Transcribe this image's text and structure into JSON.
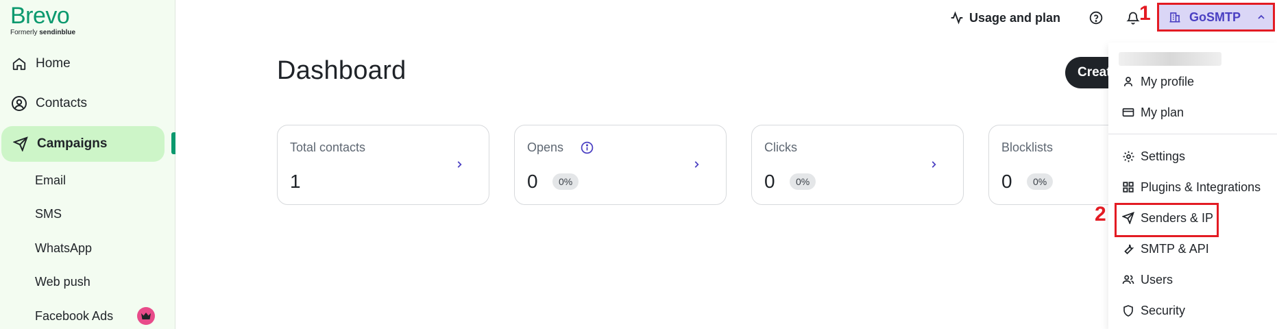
{
  "brand": {
    "name": "Brevo",
    "formerly_prefix": "Formerly",
    "formerly_name": "sendinblue"
  },
  "sidebar": {
    "items": [
      {
        "label": "Home",
        "icon": "home-icon"
      },
      {
        "label": "Contacts",
        "icon": "contacts-icon"
      },
      {
        "label": "Campaigns",
        "icon": "send-icon",
        "active": true
      }
    ],
    "subitems": [
      {
        "label": "Email"
      },
      {
        "label": "SMS"
      },
      {
        "label": "WhatsApp"
      },
      {
        "label": "Web push"
      },
      {
        "label": "Facebook Ads",
        "badge_icon": "crown-icon"
      }
    ]
  },
  "topbar": {
    "usage_label": "Usage and plan",
    "account_label": "GoSMTP",
    "annotation_1": "1",
    "annotation_2": "2"
  },
  "main": {
    "title": "Dashboard",
    "create_label": "Create",
    "cards": [
      {
        "label": "Total contacts",
        "value": "1"
      },
      {
        "label": "Opens",
        "value": "0",
        "pct": "0%"
      },
      {
        "label": "Clicks",
        "value": "0",
        "pct": "0%"
      },
      {
        "label": "Blocklists",
        "value": "0",
        "pct": "0%"
      }
    ]
  },
  "dropdown": {
    "items": [
      {
        "label": "My profile",
        "icon": "user-icon"
      },
      {
        "label": "My plan",
        "icon": "card-icon"
      },
      {
        "label": "Settings",
        "icon": "gear-icon"
      },
      {
        "label": "Plugins & Integrations",
        "icon": "grid-icon"
      },
      {
        "label": "Senders & IP",
        "icon": "send-icon"
      },
      {
        "label": "SMTP & API",
        "icon": "wrench-icon"
      },
      {
        "label": "Users",
        "icon": "users-icon"
      },
      {
        "label": "Security",
        "icon": "shield-icon"
      }
    ]
  },
  "colors": {
    "brand_green": "#0b996e",
    "active_bg": "#cdf5c8",
    "account_bg": "#dad6f6",
    "accent_purple": "#4a3fc2",
    "annotation_red": "#e31b23"
  }
}
